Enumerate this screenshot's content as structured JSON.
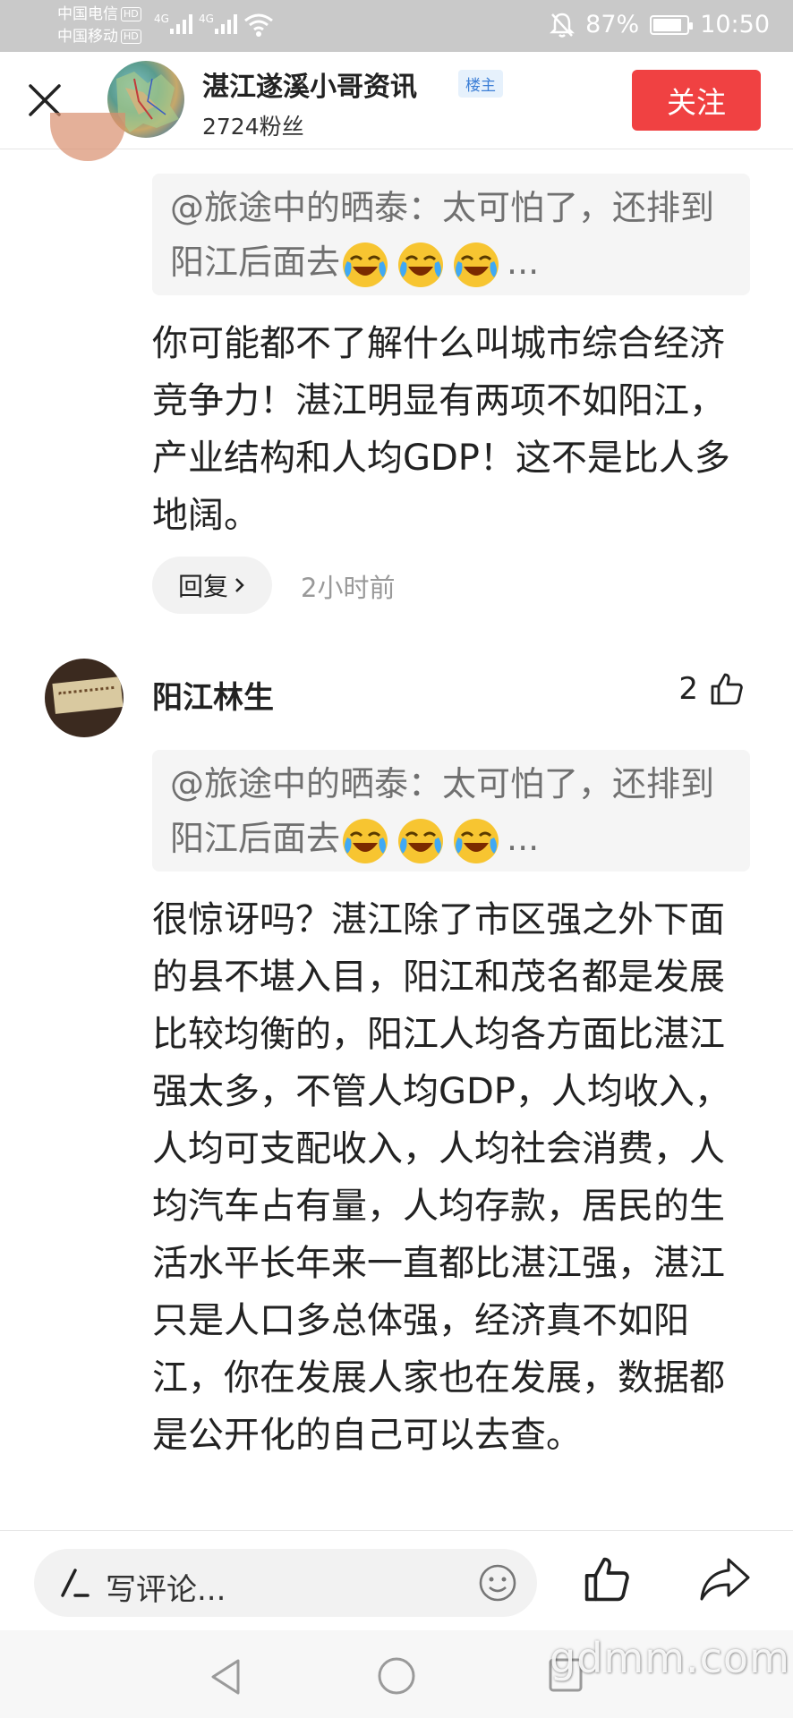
{
  "status_bar": {
    "carrier1": "中国电信",
    "carrier2": "中国移动",
    "hd": "HD",
    "net1": "4G",
    "net2": "4G",
    "battery_percent": "87%",
    "battery_level": 0.87,
    "time": "10:50"
  },
  "header": {
    "author_name": "湛江遂溪小哥资讯",
    "owner_tag": "楼主",
    "fans": "2724粉丝",
    "follow_label": "关注"
  },
  "comment1": {
    "quote_text": "@旅途中的晒泰：太可怕了，还排到阳江后面去",
    "quote_tail": "...",
    "body": "你可能都不了解什么叫城市综合经济竞争力！湛江明显有两项不如阳江，产业结构和人均GDP！这不是比人多地阔。",
    "reply_label": "回复",
    "time": "2小时前"
  },
  "comment2": {
    "user": "阳江林生",
    "likes": "2",
    "quote_text": "@旅途中的晒泰：太可怕了，还排到阳江后面去",
    "quote_tail": "...",
    "body": "很惊讶吗？湛江除了市区强之外下面的县不堪入目，阳江和茂名都是发展比较均衡的，阳江人均各方面比湛江强太多，不管人均GDP，人均收入，人均可支配收入，人均社会消费，人均汽车占有量，人均存款，居民的生活水平长年来一直都比湛江强，湛江只是人口多总体强，经济真不如阳江，你在发展人家也在发展，数据都是公开化的自己可以去查。"
  },
  "bottom_bar": {
    "input_placeholder": "写评论..."
  },
  "watermark": "gdmm.com",
  "colors": {
    "accent_red": "#f04142",
    "owner_tag_blue": "#3d7fd6",
    "quote_bg": "#f5f5f5",
    "emoji_yellow": "#f7c531",
    "emoji_tear": "#3fa9f5"
  }
}
